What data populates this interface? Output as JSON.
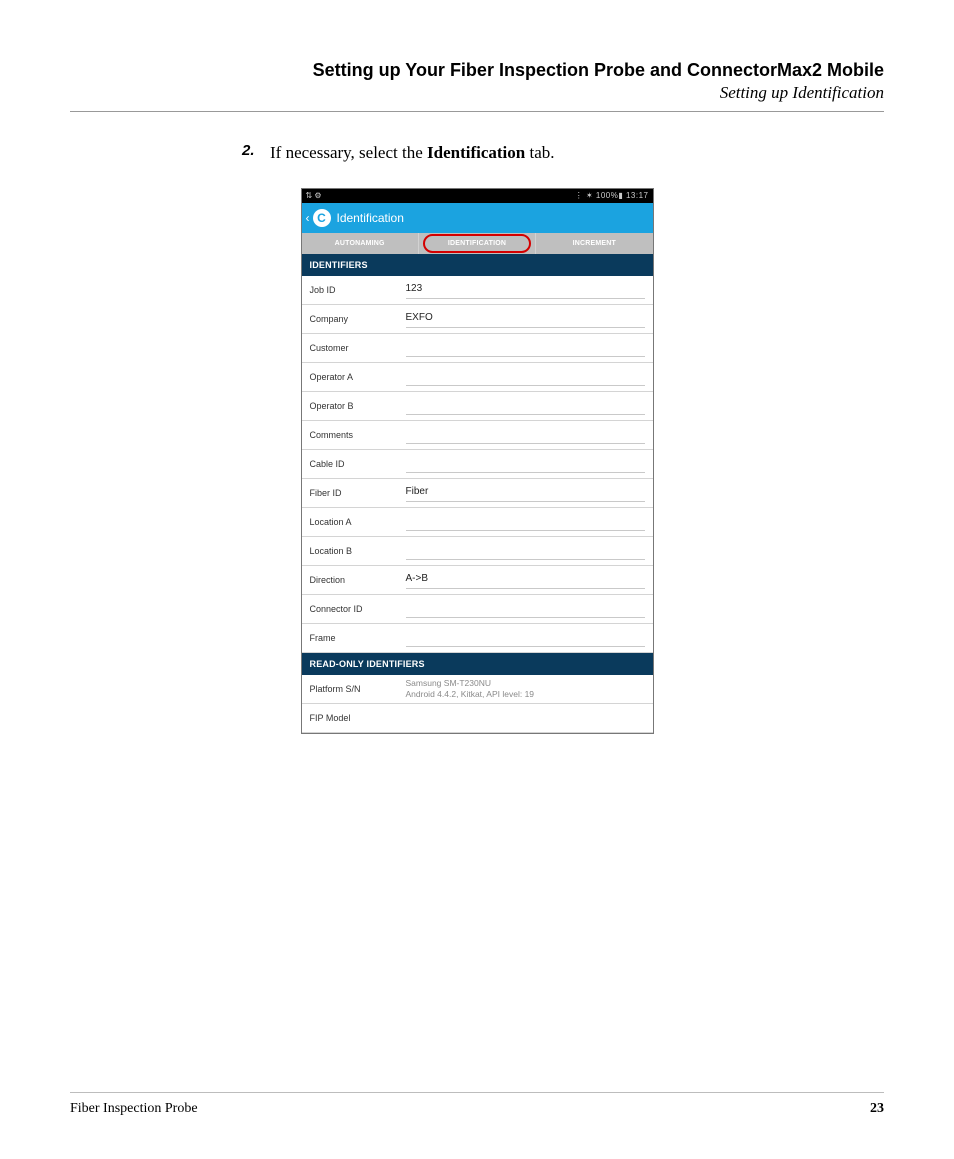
{
  "chapter_title": "Setting up Your Fiber Inspection Probe and ConnectorMax2 Mobile",
  "section_title": "Setting up Identification",
  "step": {
    "num": "2.",
    "pre": "If necessary, select the ",
    "bold": "Identification",
    "post": " tab."
  },
  "screenshot": {
    "status": {
      "left_icons": "⇅  ⚙",
      "right": "⋮  ✶  100%▮ 13:17"
    },
    "appbar": {
      "back": "‹",
      "logo": "C",
      "title": "Identification"
    },
    "tabs": {
      "t1": "AUTONAMING",
      "t2": "IDENTIFICATION",
      "t3": "INCREMENT"
    },
    "identifiers_hdr": "IDENTIFIERS",
    "rows": [
      {
        "label": "Job ID",
        "value": "123"
      },
      {
        "label": "Company",
        "value": "EXFO"
      },
      {
        "label": "Customer",
        "value": ""
      },
      {
        "label": "Operator A",
        "value": ""
      },
      {
        "label": "Operator B",
        "value": ""
      },
      {
        "label": "Comments",
        "value": ""
      },
      {
        "label": "Cable ID",
        "value": ""
      },
      {
        "label": "Fiber ID",
        "value": "Fiber"
      },
      {
        "label": "Location A",
        "value": ""
      },
      {
        "label": "Location B",
        "value": ""
      },
      {
        "label": "Direction",
        "value": "A->B"
      },
      {
        "label": "Connector ID",
        "value": ""
      },
      {
        "label": "Frame",
        "value": ""
      }
    ],
    "readonly_hdr": "READ-ONLY IDENTIFIERS",
    "readonly_rows": [
      {
        "label": "Platform S/N",
        "value": "Samsung SM-T230NU\nAndroid 4.4.2, Kitkat, API level: 19"
      },
      {
        "label": "FIP Model",
        "value": ""
      }
    ]
  },
  "footer": {
    "left": "Fiber Inspection Probe",
    "right": "23"
  }
}
